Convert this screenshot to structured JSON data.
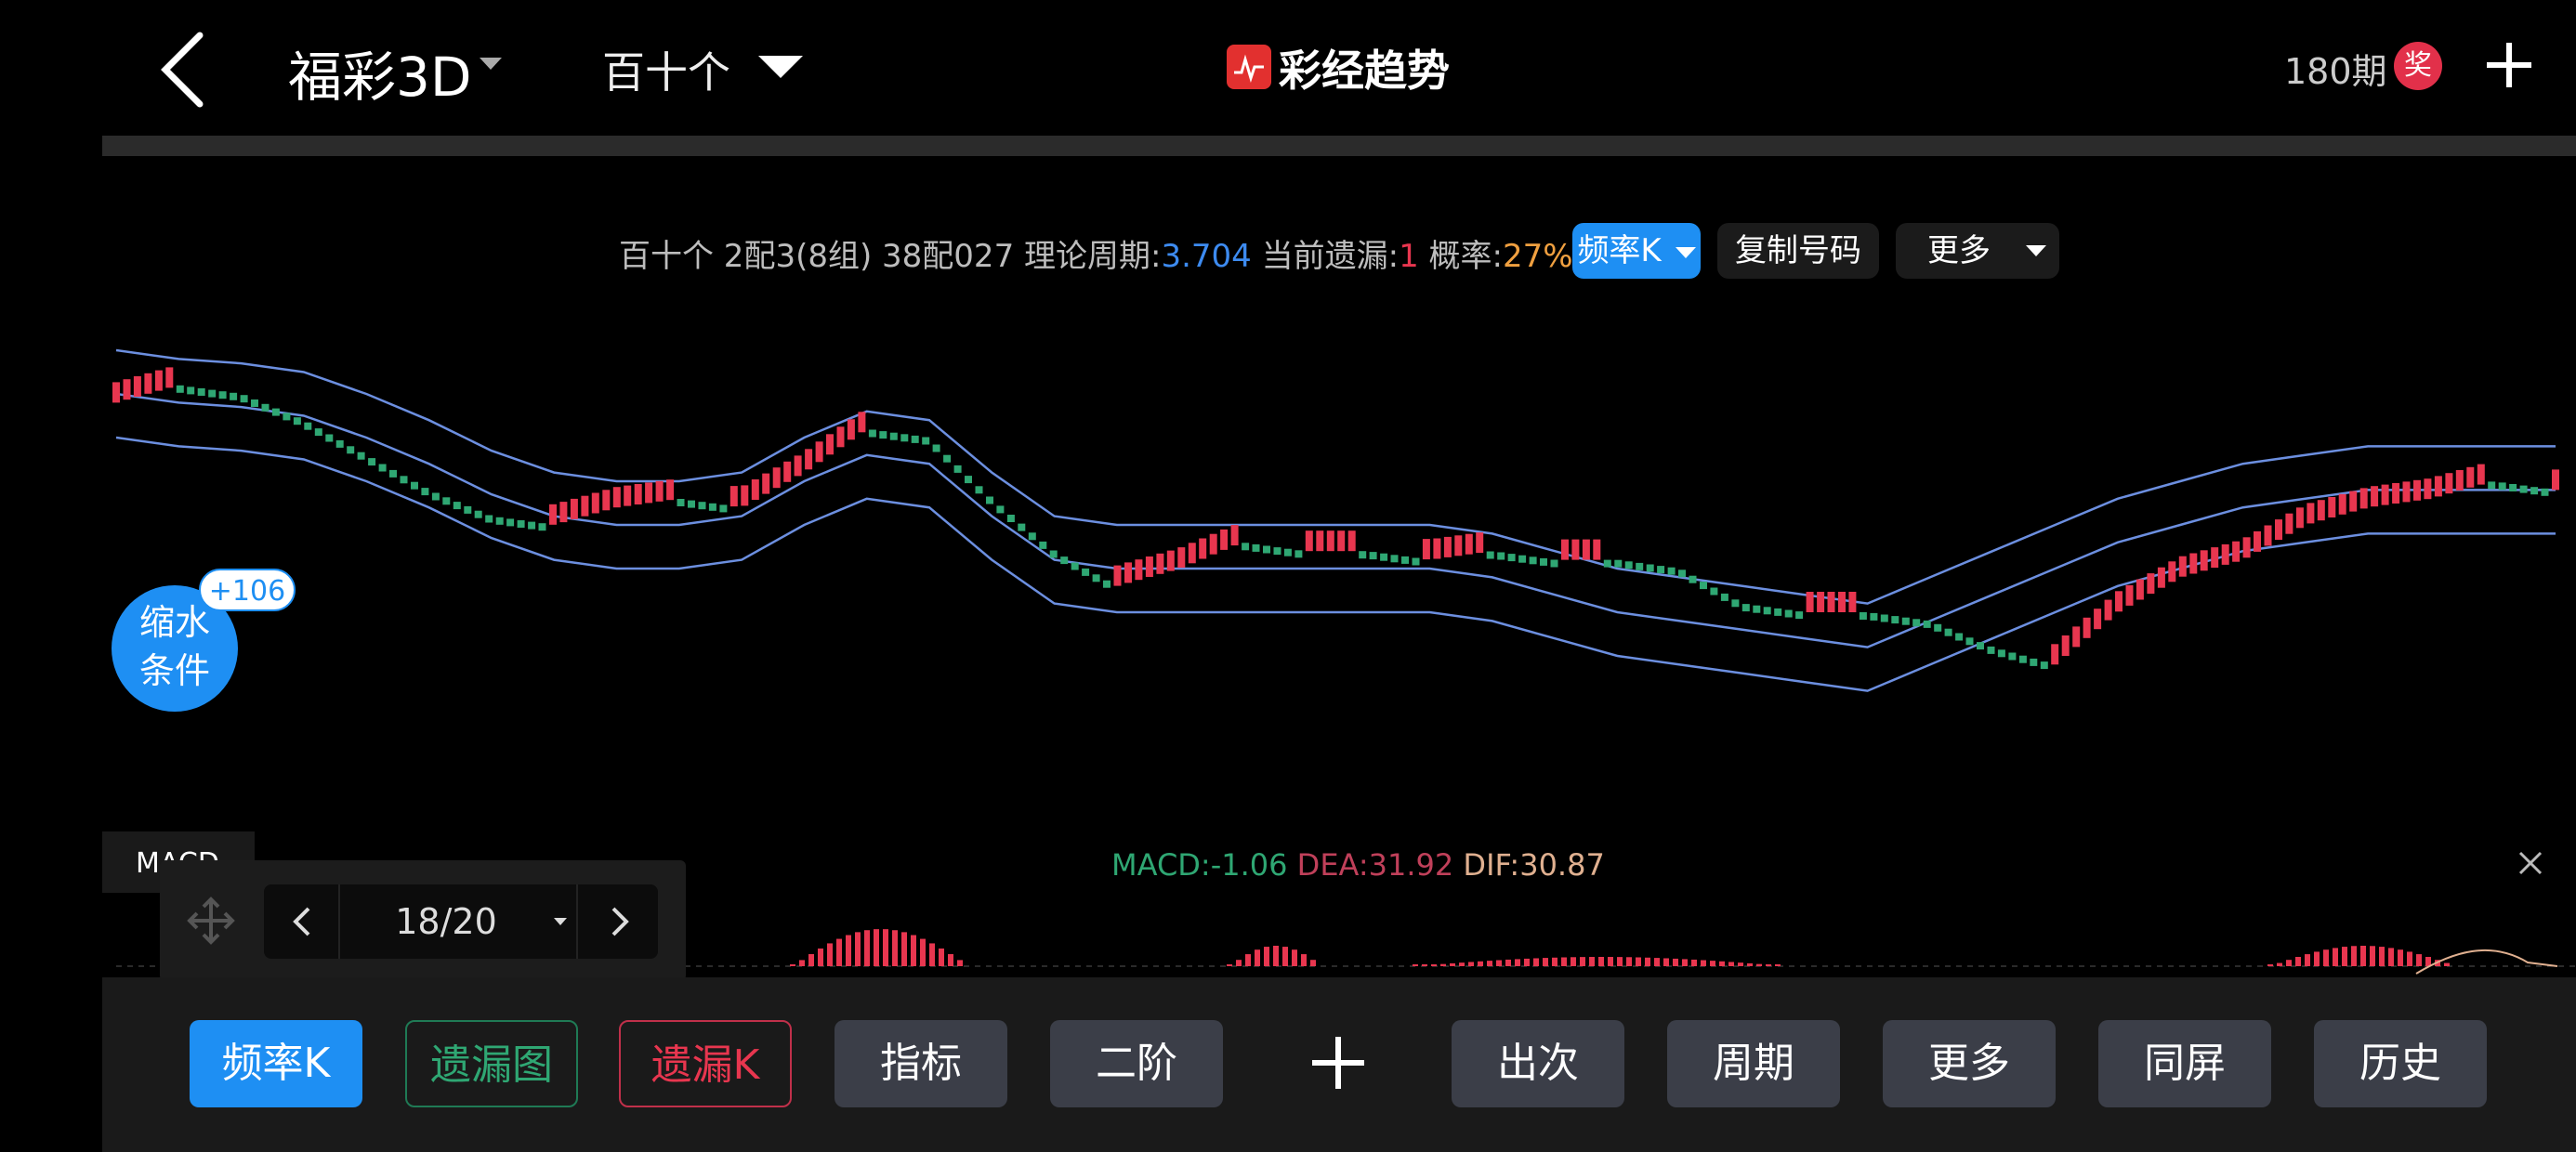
{
  "header": {
    "lottery": "福彩3D",
    "position": "百十个",
    "brand": "彩经趋势",
    "periods": "180期",
    "prize_label": "奖"
  },
  "info": {
    "prefix": "百十个 2配3(8组) 38配027 理论周期:",
    "theory_period": "3.704",
    "missing_label": " 当前遗漏:",
    "missing_value": "1",
    "prob_label": " 概率:",
    "prob_value": "27%",
    "freq_k_button": "频率K",
    "copy_button": "复制号码",
    "more_button": "更多"
  },
  "shrink": {
    "label_line1": "缩水",
    "label_line2": "条件",
    "badge": "+106"
  },
  "macd": {
    "tab_label": "MACD",
    "macd_text": "MACD:-1.06",
    "dea_text": "DEA:31.92",
    "dif_text": "DIF:30.87"
  },
  "pager": {
    "text": "18/20"
  },
  "toolbar": {
    "freq_k": "频率K",
    "missing_chart": "遗漏图",
    "missing_k": "遗漏K",
    "indicator": "指标",
    "second_order": "二阶",
    "appear": "出次",
    "period": "周期",
    "more": "更多",
    "same_screen": "同屏",
    "history": "历史"
  },
  "colors": {
    "up": "#e8364f",
    "down": "#2fa773",
    "band": "#6c8fe0",
    "accent": "#1e8ff3",
    "dea": "#c0405a",
    "dif": "#e0b090"
  },
  "chart_data": {
    "type": "line",
    "description_series": "频率K trend with Bollinger bands",
    "series": [
      {
        "name": "middle",
        "values": [
          80,
          78,
          77,
          75,
          70,
          64,
          57,
          52,
          50,
          50,
          52,
          60,
          66,
          64,
          52,
          42,
          40,
          40,
          40,
          40,
          40,
          40,
          38,
          34,
          30,
          28,
          26,
          24,
          22,
          28,
          34,
          40,
          46,
          50,
          54,
          56,
          58,
          58,
          58,
          58
        ]
      },
      {
        "name": "price",
        "values": [
          78,
          82,
          80,
          74,
          66,
          58,
          52,
          50,
          54,
          56,
          54,
          62,
          72,
          70,
          56,
          44,
          36,
          40,
          46,
          44,
          44,
          42,
          44,
          42,
          42,
          40,
          32,
          30,
          30,
          28,
          22,
          18,
          30,
          38,
          42,
          50,
          54,
          56,
          60,
          58
        ]
      }
    ]
  }
}
